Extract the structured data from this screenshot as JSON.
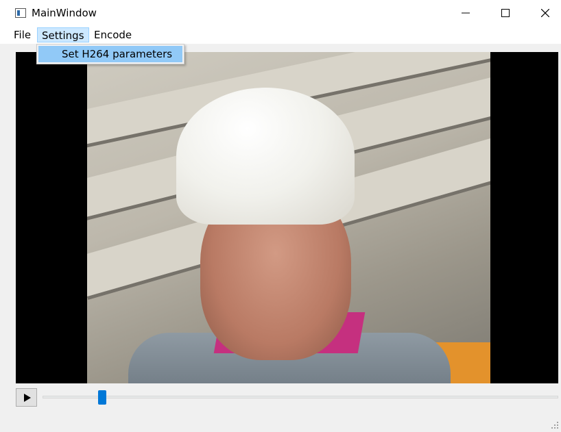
{
  "window": {
    "title": "MainWindow"
  },
  "menubar": {
    "items": [
      "File",
      "Settings",
      "Encode"
    ]
  },
  "settings_menu": {
    "items": [
      "Set H264 parameters"
    ]
  },
  "player": {
    "position_fraction": 0.11
  },
  "icons": [
    "app-icon",
    "minimize-icon",
    "maximize-icon",
    "close-icon",
    "play-icon",
    "resize-grip-icon"
  ]
}
